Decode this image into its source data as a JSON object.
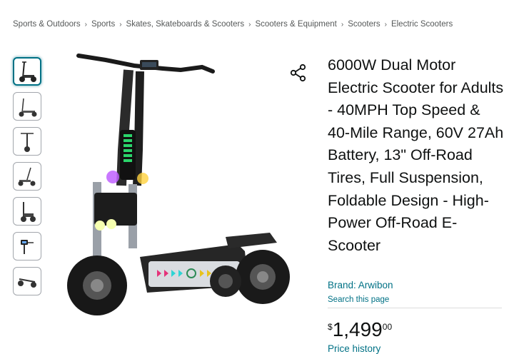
{
  "breadcrumb": {
    "items": [
      "Sports & Outdoors",
      "Sports",
      "Skates, Skateboards & Scooters",
      "Scooters & Equipment",
      "Scooters",
      "Electric Scooters"
    ],
    "separator": "›"
  },
  "product": {
    "title": "6000W Dual Motor Electric Scooter for Adults - 40MPH Top Speed & 40-Mile Range, 60V 27Ah Battery, 13\" Off-Road Tires, Full Suspension, Foldable Design - High-Power Off-Road E-Scooter",
    "brand_link": "Brand: Arwibon",
    "search_page_link": "Search this page",
    "price": {
      "symbol": "$",
      "whole": "1,499",
      "fraction": "00"
    },
    "price_history_link": "Price history"
  },
  "gallery": {
    "thumbnail_count": 7,
    "selected_index": 0
  },
  "icons": {
    "share": "share-icon"
  },
  "colors": {
    "link": "#007185",
    "text": "#0f1111",
    "muted": "#565959",
    "thumb_active": "#007185"
  }
}
